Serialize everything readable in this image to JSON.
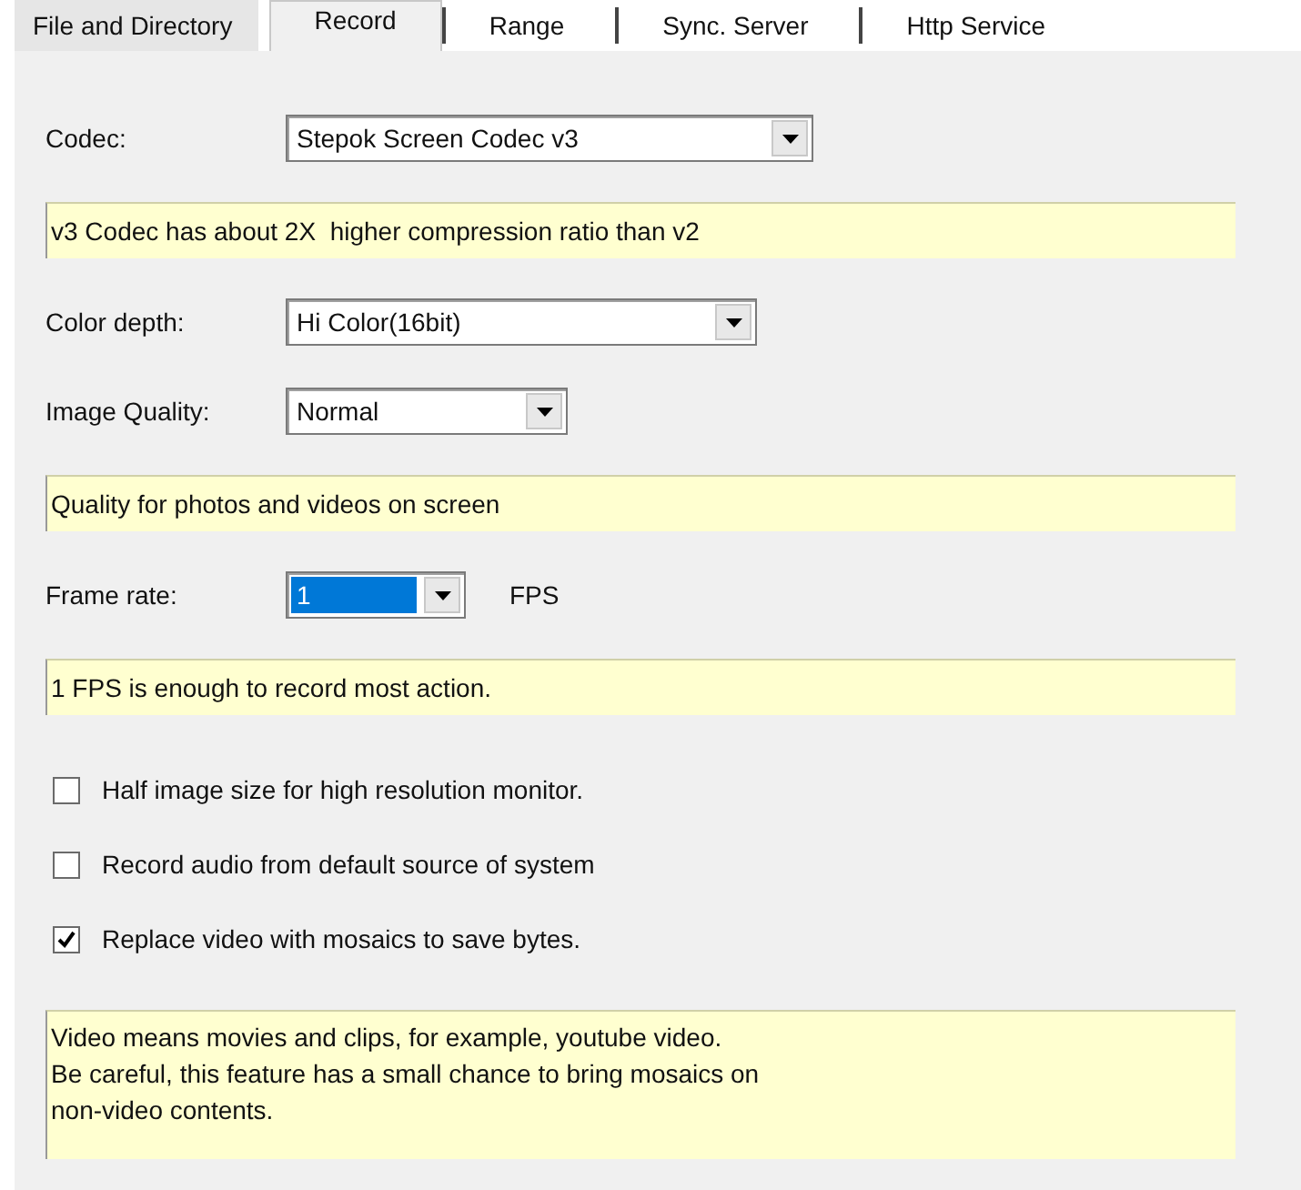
{
  "tabs": [
    {
      "label": "File and Directory",
      "selected": false
    },
    {
      "label": "Record",
      "selected": true
    },
    {
      "label": "Range",
      "selected": false
    },
    {
      "label": "Sync. Server",
      "selected": false
    },
    {
      "label": "Http Service",
      "selected": false
    }
  ],
  "settings": [
    {
      "kind": "dropdown",
      "label": "Codec:",
      "value": "Stepok Screen Codec v3",
      "highlighted": false
    },
    {
      "kind": "note",
      "lines": [
        "v3 Codec has about 2X  higher compression ratio than v2"
      ]
    },
    {
      "kind": "dropdown",
      "label": "Color depth:",
      "value": "Hi Color(16bit)",
      "highlighted": false
    },
    {
      "kind": "dropdown",
      "label": "Image Quality:",
      "value": "Normal",
      "highlighted": false
    },
    {
      "kind": "note",
      "lines": [
        "Quality for photos and videos on screen"
      ]
    },
    {
      "kind": "dropdown",
      "label": "Frame rate:",
      "value": "1",
      "highlighted": true,
      "unit": "FPS"
    },
    {
      "kind": "note",
      "lines": [
        "1 FPS is enough to record most action."
      ]
    },
    {
      "kind": "checkbox",
      "label": "Half image size for high resolution monitor.",
      "checked": false
    },
    {
      "kind": "checkbox",
      "label": "Record audio from default source of system",
      "checked": false
    },
    {
      "kind": "checkbox",
      "label": "Replace video with mosaics to save bytes.",
      "checked": true
    },
    {
      "kind": "note",
      "lines": [
        "Video means movies and clips, for example, youtube video.",
        "Be careful, this feature has a small chance to bring mosaics on",
        "non-video contents."
      ]
    }
  ]
}
